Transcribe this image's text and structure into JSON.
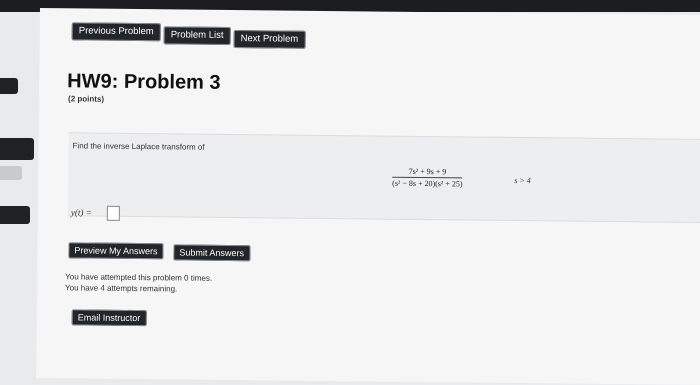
{
  "nav": {
    "previous_label": "Previous Problem",
    "list_label": "Problem List",
    "next_label": "Next Problem"
  },
  "header": {
    "title": "HW9: Problem 3",
    "points": "(2 points)"
  },
  "problem": {
    "prompt": "Find the inverse Laplace transform of",
    "numerator": "7s² + 9s + 9",
    "denominator": "(s² − 8s + 20)(s² + 25)",
    "condition": "s > 4",
    "answer_label": "y(t) =",
    "answer_value": ""
  },
  "actions": {
    "preview_label": "Preview My Answers",
    "submit_label": "Submit Answers"
  },
  "status": {
    "attempts_line": "You have attempted this problem 0 times.",
    "remaining_line": "You have 4 attempts remaining."
  },
  "footer": {
    "email_label": "Email Instructor"
  }
}
